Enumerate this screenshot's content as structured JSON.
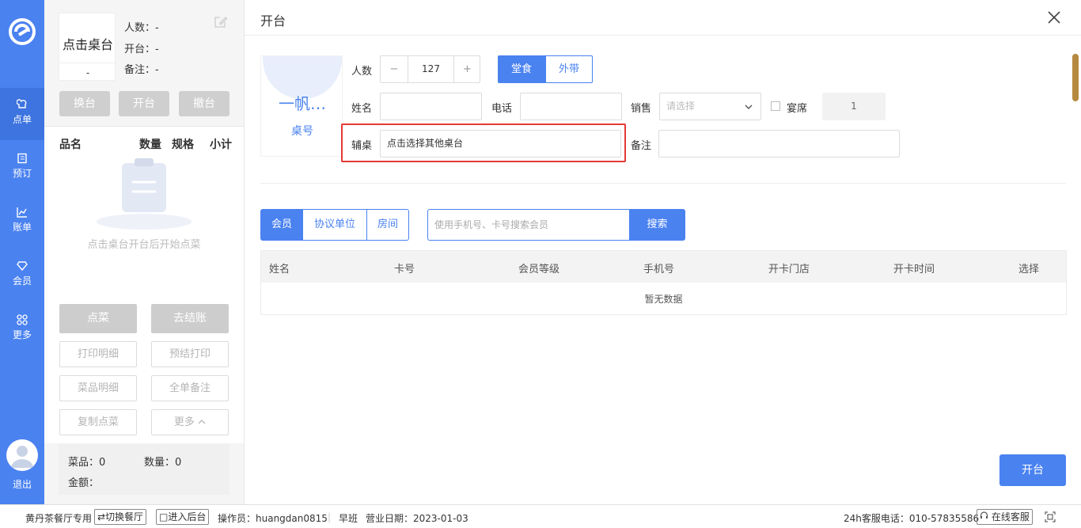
{
  "nav": {
    "items": [
      {
        "label": "点单",
        "icon": "chef-hat-icon"
      },
      {
        "label": "预订",
        "icon": "book-icon"
      },
      {
        "label": "账单",
        "icon": "chart-icon"
      },
      {
        "label": "会员",
        "icon": "diamond-icon"
      },
      {
        "label": "更多",
        "icon": "grid-icon"
      }
    ],
    "logout": "退出"
  },
  "order": {
    "table_name": "点击桌台",
    "table_dash": "-",
    "info": [
      "人数：-",
      "开台：-",
      "备注：-"
    ],
    "actions": [
      "换台",
      "开台",
      "撤台"
    ],
    "columns": [
      "品名",
      "数量",
      "规格",
      "小计"
    ],
    "empty_text": "点击桌台开台后开始点菜",
    "big_buttons": [
      "点菜",
      "去结账"
    ],
    "outline_buttons": [
      "打印明细",
      "预结打印",
      "菜品明细",
      "全单备注",
      "复制点菜",
      "更多"
    ],
    "summary": {
      "dishes": "菜品：0",
      "qty": "数量：0",
      "amount": "金额："
    }
  },
  "dialog": {
    "title": "开台",
    "table_card": {
      "name": "一帆…",
      "label": "桌号"
    },
    "form": {
      "people_label": "人数",
      "people_value": "127",
      "minus": "−",
      "plus": "+",
      "mode_dine": "堂食",
      "mode_takeout": "外带",
      "name_label": "姓名",
      "phone_label": "电话",
      "sales_label": "销售",
      "sales_placeholder": "请选择",
      "banquet_label": "宴席",
      "banquet_value": "1",
      "aux_label": "辅桌",
      "aux_placeholder": "点击选择其他桌台",
      "remark_label": "备注"
    },
    "tabs": [
      "会员",
      "协议单位",
      "房间"
    ],
    "search_placeholder": "使用手机号、卡号搜索会员",
    "search_button": "搜索",
    "table_headers": [
      "姓名",
      "卡号",
      "会员等级",
      "手机号",
      "开卡门店",
      "开卡时间",
      "选择"
    ],
    "no_data": "暂无数据",
    "open_button": "开台"
  },
  "status": {
    "store": "黄丹茶餐厅专用",
    "switch": "⇄切换餐厅",
    "backend": "□进入后台",
    "operator": "操作员：huangdan0815",
    "shift": "早班",
    "biz_date": "营业日期：2023-01-03",
    "hotline": "24h客服电话：010-57835586",
    "online": "在线客服"
  },
  "colors": {
    "primary": "#4a82f0",
    "highlight": "#e53935"
  }
}
